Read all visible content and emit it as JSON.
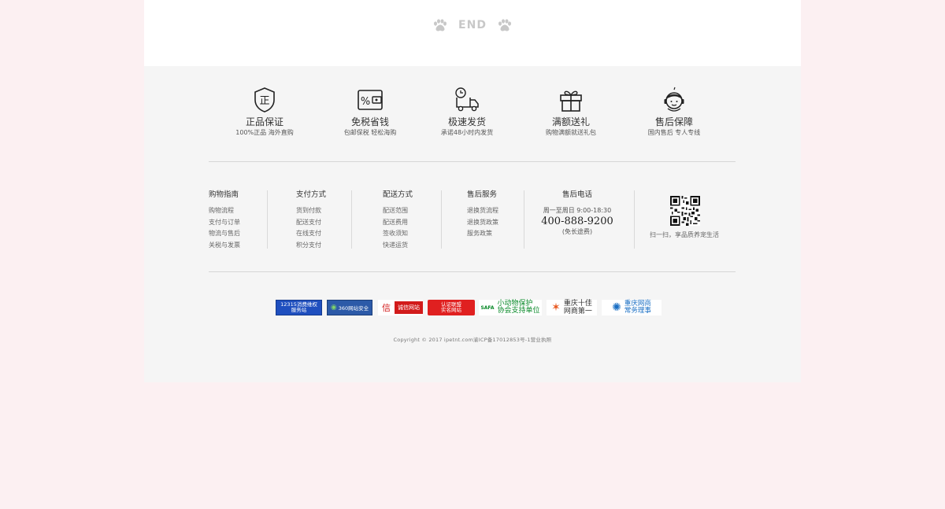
{
  "end": {
    "label": "END"
  },
  "features": [
    {
      "icon": "shield-icon",
      "title": "正品保证",
      "sub": "100%正品 海外直购",
      "glyph": "正"
    },
    {
      "icon": "percent-wallet-icon",
      "title": "免税省钱",
      "sub": "包邮保税 轻松海购"
    },
    {
      "icon": "delivery-truck-icon",
      "title": "极速发货",
      "sub": "承诺48小时内发货"
    },
    {
      "icon": "gift-icon",
      "title": "满额送礼",
      "sub": "购物满额就送礼包"
    },
    {
      "icon": "customer-service-icon",
      "title": "售后保障",
      "sub": "国内售后 专人专线"
    }
  ],
  "columns": [
    {
      "title": "购物指南",
      "items": [
        "购物流程",
        "支付与订单",
        "物流与售后",
        "关税与发票"
      ]
    },
    {
      "title": "支付方式",
      "items": [
        "货到付款",
        "配送支付",
        "在线支付",
        "积分支付"
      ]
    },
    {
      "title": "配送方式",
      "items": [
        "配送范围",
        "配送费用",
        "签收须知",
        "快递运货"
      ]
    },
    {
      "title": "售后服务",
      "items": [
        "退换货流程",
        "退换货政策",
        "服务政策"
      ]
    }
  ],
  "service": {
    "title": "售后电话",
    "hours": "周一至周日 9:00-18:30",
    "phone": "400-888-9200",
    "note": "(免长途费)"
  },
  "qr": {
    "caption": "扫一扫，享品质养宠生活"
  },
  "badges": {
    "b1_line1": "12315消费维权",
    "b1_line2": "服务站",
    "b2": "360网站安全",
    "b3_glyph": "信",
    "b3": "诚信网站",
    "b4_line1": "认证联盟",
    "b4_line2": "实名网站",
    "b5_logo": "SAFA",
    "b5_line1": "小动物保护",
    "b5_line2": "协会支持单位",
    "b6_line1": "重庆十佳",
    "b6_line2": "网商第一",
    "b7_line1": "重庆网商",
    "b7_line2": "常务理事"
  },
  "copyright": "Copyright © 2017 ipetnt.com渝ICP备17012853号-1营业执照",
  "colors": {
    "page_bg": "#fcf0f2",
    "footer_bg": "#f5f5f5",
    "end_text": "#c8c8c8"
  }
}
